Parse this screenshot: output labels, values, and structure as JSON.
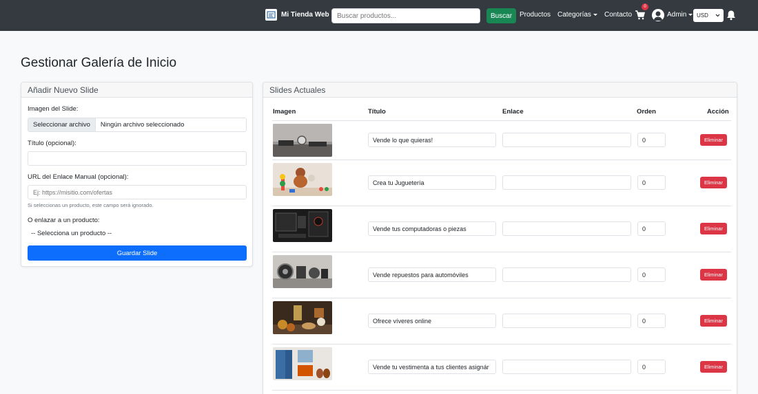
{
  "navbar": {
    "brand": "Mi Tienda Web",
    "search_placeholder": "Buscar productos...",
    "search_button": "Buscar",
    "links": {
      "productos": "Productos",
      "categorias": "Categorías",
      "contacto": "Contacto"
    },
    "cart_count": "0",
    "user": "Admin",
    "currency": "USD"
  },
  "page_title": "Gestionar Galería de Inicio",
  "add_form": {
    "header": "Añadir Nuevo Slide",
    "image_label": "Imagen del Slide:",
    "file_button": "Seleccionar archivo",
    "file_status": "Ningún archivo seleccionado",
    "title_label": "Título (opcional):",
    "title_value": "",
    "url_label": "URL del Enlace Manual (opcional):",
    "url_placeholder": "Ej: https://misitio.com/ofertas",
    "url_help": "Si seleccionas un producto, este campo será ignorado.",
    "product_label": "O enlazar a un producto:",
    "product_select": "-- Selecciona un producto --",
    "save_button": "Guardar Slide"
  },
  "slides": {
    "header": "Slides Actuales",
    "columns": [
      "Imagen",
      "Título",
      "Enlace",
      "Orden",
      "Acción"
    ],
    "delete_label": "Eliminar",
    "rows": [
      {
        "title": "Vende lo que quieras!",
        "link": "",
        "order": "0",
        "image": "electronics-desk-photo"
      },
      {
        "title": "Crea tu Juguetería",
        "link": "",
        "order": "0",
        "image": "toys-photo"
      },
      {
        "title": "Vende tus computadoras o piezas",
        "link": "",
        "order": "0",
        "image": "computer-parts-photo"
      },
      {
        "title": "Vende repuestos para automóviles",
        "link": "",
        "order": "0",
        "image": "auto-parts-photo"
      },
      {
        "title": "Ofrece víveres online",
        "link": "",
        "order": "0",
        "image": "groceries-photo"
      },
      {
        "title": "Vende tu vestimenta a tus clientes asignár",
        "link": "",
        "order": "0",
        "image": "clothing-photo"
      }
    ]
  }
}
